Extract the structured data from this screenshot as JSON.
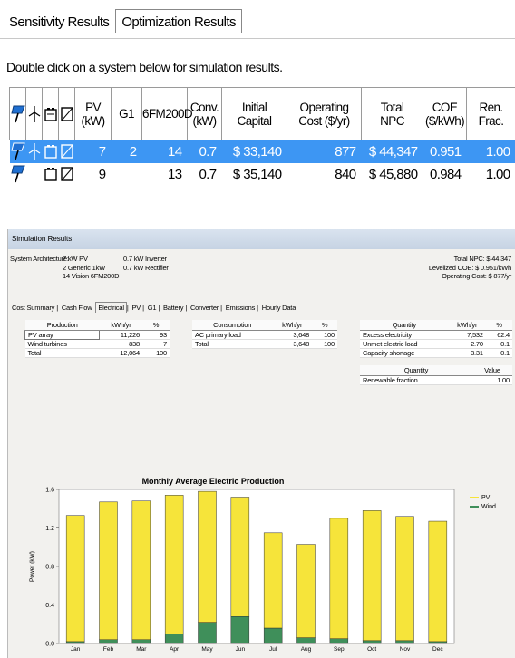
{
  "tabs": {
    "sensitivity": "Sensitivity Results",
    "optimization": "Optimization Results"
  },
  "instruction": "Double click on a system below for simulation results.",
  "table": {
    "headers": [
      "PV\n(kW)",
      "G1",
      "6FM200D",
      "Conv.\n(kW)",
      "Initial\nCapital",
      "Operating\nCost ($/yr)",
      "Total\nNPC",
      "COE\n($/kWh)",
      "Ren.\nFrac."
    ],
    "rows": [
      {
        "pv": "7",
        "g1": "2",
        "batt": "14",
        "conv": "0.7",
        "capital": "$ 33,140",
        "op": "877",
        "npc": "$ 44,347",
        "coe": "0.951",
        "ren": "1.00"
      },
      {
        "pv": "9",
        "g1": "",
        "batt": "13",
        "conv": "0.7",
        "capital": "$ 35,140",
        "op": "840",
        "npc": "$ 45,880",
        "coe": "0.984",
        "ren": "1.00"
      }
    ]
  },
  "sim": {
    "title": "Simulation Results",
    "arch_label": "System Architecture:",
    "arch": [
      "7 kW PV",
      "2 Generic 1kW",
      "14 Vision 6FM200D"
    ],
    "arch2": [
      "0.7 kW Inverter",
      "0.7 kW Rectifier"
    ],
    "summary": [
      "Total NPC: $ 44,347",
      "Levelized COE: $ 0.951/kWh",
      "Operating Cost: $ 877/yr"
    ],
    "tabs": [
      "Cost Summary",
      "Cash Flow",
      "Electrical",
      "PV",
      "G1",
      "Battery",
      "Converter",
      "Emissions",
      "Hourly Data"
    ],
    "production": {
      "headers": [
        "Production",
        "kWh/yr",
        "%"
      ],
      "rows": [
        [
          "PV array",
          "11,226",
          "93"
        ],
        [
          "Wind turbines",
          "838",
          "7"
        ],
        [
          "Total",
          "12,064",
          "100"
        ]
      ]
    },
    "consumption": {
      "headers": [
        "Consumption",
        "kWh/yr",
        "%"
      ],
      "rows": [
        [
          "AC primary load",
          "3,648",
          "100"
        ],
        [
          "Total",
          "3,648",
          "100"
        ]
      ]
    },
    "quantity": {
      "headers": [
        "Quantity",
        "kWh/yr",
        "%"
      ],
      "rows": [
        [
          "Excess electricity",
          "7,532",
          "62.4"
        ],
        [
          "Unmet electric load",
          "2.70",
          "0.1"
        ],
        [
          "Capacity shortage",
          "3.31",
          "0.1"
        ]
      ]
    },
    "renewable": {
      "headers": [
        "Quantity",
        "Value"
      ],
      "rows": [
        [
          "Renewable fraction",
          "1.00"
        ]
      ]
    }
  },
  "colors": {
    "pv": "#f6e43a",
    "wind": "#3f8f5a",
    "selected": "#3d96f3"
  },
  "chart_data": {
    "type": "bar",
    "title": "Monthly Average Electric Production",
    "ylabel": "Power (kW)",
    "ylim": [
      0,
      1.6
    ],
    "yticks": [
      "0.0",
      "0.4",
      "0.8",
      "1.2",
      "1.6"
    ],
    "categories": [
      "Jan",
      "Feb",
      "Mar",
      "Apr",
      "May",
      "Jun",
      "Jul",
      "Aug",
      "Sep",
      "Oct",
      "Nov",
      "Dec"
    ],
    "series": [
      {
        "name": "Wind",
        "values": [
          0.02,
          0.04,
          0.04,
          0.1,
          0.22,
          0.28,
          0.16,
          0.06,
          0.05,
          0.03,
          0.03,
          0.02
        ]
      },
      {
        "name": "PV",
        "values": [
          1.31,
          1.43,
          1.44,
          1.44,
          1.36,
          1.24,
          0.99,
          0.97,
          1.25,
          1.35,
          1.29,
          1.25
        ]
      }
    ]
  }
}
